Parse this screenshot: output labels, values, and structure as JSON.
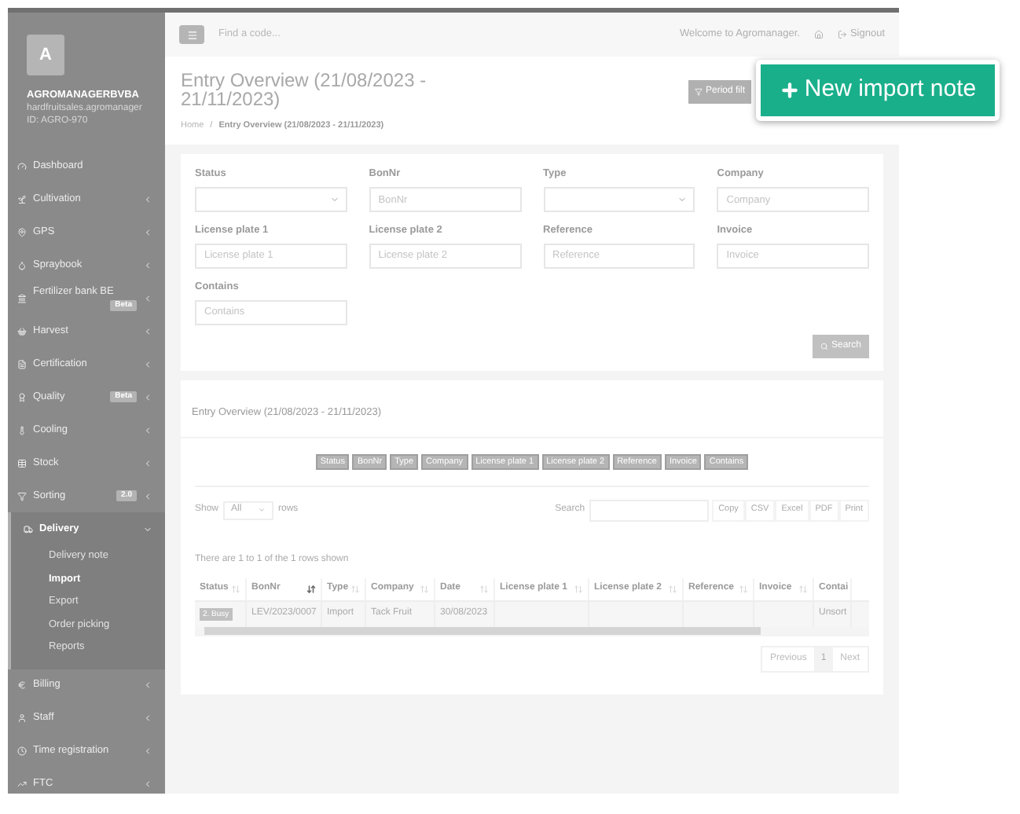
{
  "sidebar": {
    "avatar_letter": "A",
    "company": "AGROMANAGERBVBA",
    "user": "hardfruitsales.agromanager",
    "id": "ID: AGRO-970",
    "items": [
      {
        "label": "Dashboard",
        "kind": "link",
        "expanded": false
      },
      {
        "label": "Cultivation",
        "kind": "menu",
        "expanded": false
      },
      {
        "label": "GPS",
        "kind": "menu",
        "expanded": false
      },
      {
        "label": "Spraybook",
        "kind": "menu",
        "expanded": false
      },
      {
        "label": "Fertilizer bank BE",
        "kind": "menu",
        "expanded": false,
        "badge": "Beta"
      },
      {
        "label": "Harvest",
        "kind": "menu",
        "expanded": false
      },
      {
        "label": "Certification",
        "kind": "menu",
        "expanded": false
      },
      {
        "label": "Quality",
        "kind": "menu",
        "expanded": false,
        "badge": "Beta"
      },
      {
        "label": "Cooling",
        "kind": "menu",
        "expanded": false
      },
      {
        "label": "Stock",
        "kind": "menu",
        "expanded": false
      },
      {
        "label": "Sorting",
        "kind": "menu",
        "expanded": false,
        "badge": "2.0"
      },
      {
        "label": "Delivery",
        "kind": "menu",
        "expanded": true,
        "children": [
          {
            "label": "Delivery note",
            "selected": false
          },
          {
            "label": "Import",
            "selected": true
          },
          {
            "label": "Export",
            "selected": false
          },
          {
            "label": "Order picking",
            "selected": false
          },
          {
            "label": "Reports",
            "selected": false
          }
        ]
      },
      {
        "label": "Billing",
        "kind": "menu",
        "expanded": false
      },
      {
        "label": "Staff",
        "kind": "menu",
        "expanded": false
      },
      {
        "label": "Time registration",
        "kind": "menu",
        "expanded": false
      },
      {
        "label": "FTC",
        "kind": "menu",
        "expanded": false
      }
    ]
  },
  "topbar": {
    "search_placeholder": "Find a code...",
    "welcome": "Welcome to Agromanager.",
    "signout": "Signout"
  },
  "header": {
    "title": "Entry Overview (21/08/2023 - 21/11/2023)",
    "breadcrumb": [
      "Home",
      "Entry Overview (21/08/2023 - 21/11/2023)"
    ],
    "breadcrumb_separator": "/",
    "period_button": "Period filt"
  },
  "new_button": "New import note",
  "filters": {
    "fields": [
      {
        "label": "Status",
        "kind": "select"
      },
      {
        "label": "BonNr",
        "kind": "input",
        "placeholder": "BonNr"
      },
      {
        "label": "Type",
        "kind": "select"
      },
      {
        "label": "Company",
        "kind": "input",
        "placeholder": "Company"
      },
      {
        "label": "License plate 1",
        "kind": "input",
        "placeholder": "License plate 1"
      },
      {
        "label": "License plate 2",
        "kind": "input",
        "placeholder": "License plate 2"
      },
      {
        "label": "Reference",
        "kind": "input",
        "placeholder": "Reference"
      },
      {
        "label": "Invoice",
        "kind": "input",
        "placeholder": "Invoice"
      },
      {
        "label": "Contains",
        "kind": "input",
        "placeholder": "Contains"
      }
    ],
    "search_button": "Search"
  },
  "table_panel": {
    "title": "Entry Overview (21/08/2023 - 21/11/2023)",
    "column_toggles": [
      "Status",
      "BonNr",
      "Type",
      "Company",
      "License plate 1",
      "License plate 2",
      "Reference",
      "Invoice",
      "Contains"
    ],
    "show_label": "Show",
    "show_value": "All",
    "rows_label": "rows",
    "search_label": "Search",
    "export_buttons": [
      "Copy",
      "CSV",
      "Excel",
      "PDF",
      "Print"
    ],
    "info": "There are 1 to 1 of the 1 rows shown",
    "columns": [
      {
        "label": "Status",
        "sorted": false
      },
      {
        "label": "BonNr",
        "sorted": true
      },
      {
        "label": "Type",
        "sorted": false
      },
      {
        "label": "Company",
        "sorted": false
      },
      {
        "label": "Date",
        "sorted": false
      },
      {
        "label": "License plate 1",
        "sorted": false
      },
      {
        "label": "License plate 2",
        "sorted": false
      },
      {
        "label": "Reference",
        "sorted": false
      },
      {
        "label": "Invoice",
        "sorted": false
      },
      {
        "label": "Contai"
      }
    ],
    "rows": [
      {
        "cells": [
          "2. Busy",
          "LEV/2023/0007",
          "Import",
          "Tack Fruit",
          "30/08/2023",
          "",
          "",
          "",
          "",
          "Unsort"
        ]
      }
    ],
    "pagination": {
      "previous": "Previous",
      "pages": [
        {
          "label": "1",
          "selected": true
        }
      ],
      "next": "Next"
    }
  }
}
